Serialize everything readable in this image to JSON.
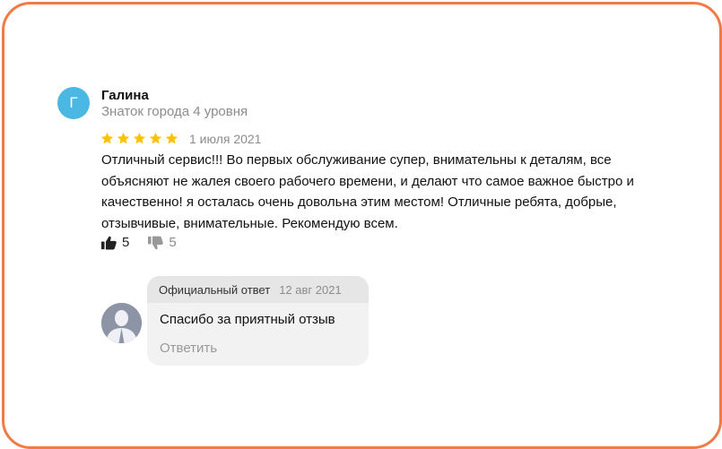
{
  "review": {
    "author": {
      "initial": "Г",
      "name": "Галина",
      "level": "Знаток города 4 уровня",
      "avatar_color": "#4bb7e3"
    },
    "rating": 5,
    "star_color": "#fcc200",
    "date": "1 июля 2021",
    "text": "Отличный сервис!!! Во первых обслуживание супер, внимательны к деталям, все объясняют не жалея своего рабочего времени, и делают что самое важное быстро и качественно! я осталась очень довольна этим местом! Отличные ребята, добрые, отзывчивые, внимательные. Рекомендую всем.",
    "likes": "5",
    "dislikes": "5"
  },
  "reply": {
    "label": "Официальный ответ",
    "date": "12 авг 2021",
    "text": "Спасибо за приятный отзыв",
    "action": "Ответить"
  },
  "frame_color": "#f47a45",
  "icons": [
    "star-icon",
    "thumbs-up-icon",
    "thumbs-down-icon",
    "person-silhouette-icon"
  ]
}
